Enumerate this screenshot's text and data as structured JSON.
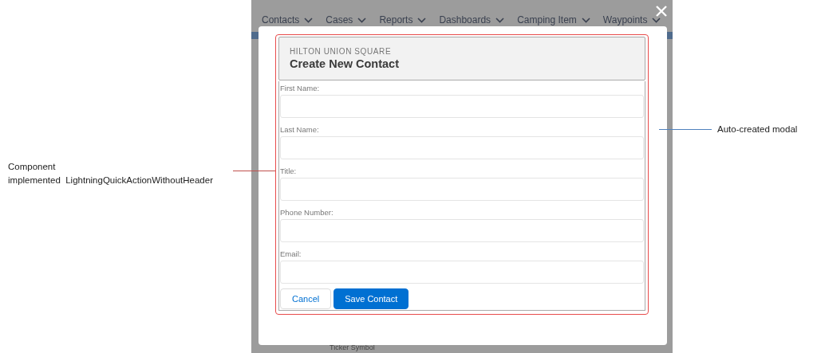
{
  "annotations": [
    {
      "kind": "left",
      "text": "Component\nimplemented  LightningQuickActionWithoutHeader",
      "color": "#c0504d"
    },
    {
      "kind": "right",
      "text": "Auto-created modal",
      "color": "#4f81bd"
    }
  ],
  "nav": [
    "Contacts",
    "Cases",
    "Reports",
    "Dashboards",
    "Camping Item",
    "Waypoints"
  ],
  "modal": {
    "subtitle": "HILTON UNION SQUARE",
    "title": "Create New Contact",
    "fields": [
      {
        "label": "First Name:"
      },
      {
        "label": "Last Name:"
      },
      {
        "label": "Title:"
      },
      {
        "label": "Phone Number:"
      },
      {
        "label": "Email:"
      }
    ],
    "buttons": [
      {
        "label": "Cancel",
        "kind": "neutral"
      },
      {
        "label": "Save Contact",
        "kind": "brand"
      }
    ]
  },
  "background_text": [
    "Ticker Symbol"
  ]
}
